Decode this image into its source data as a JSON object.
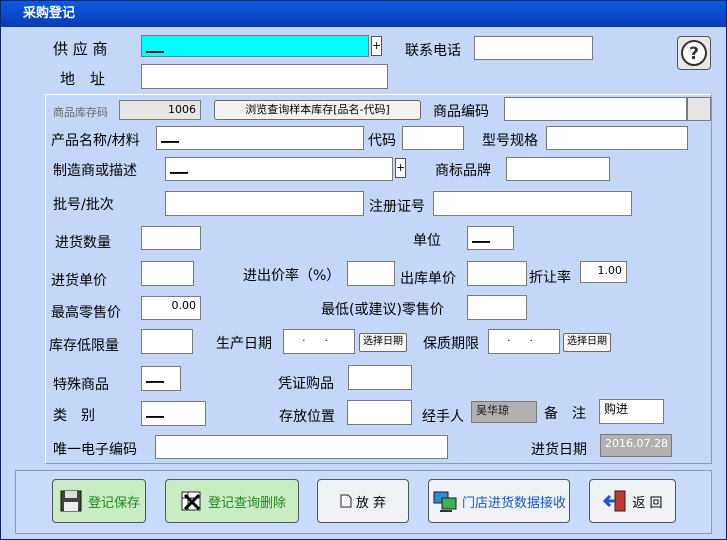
{
  "window": {
    "title": "采购登记"
  },
  "supplier": {
    "label": "供 应 商",
    "value": "___"
  },
  "phone": {
    "label": "联系电话",
    "value": ""
  },
  "address": {
    "label": "地　址",
    "value": ""
  },
  "stock_code": {
    "label": "商品库存码",
    "value": "1006"
  },
  "browse_button": {
    "label": "浏览查询样本库存[品名-代码]"
  },
  "product_code": {
    "label": "商品编码",
    "value": ""
  },
  "product_name": {
    "label": "产品名称/材料",
    "value": "___"
  },
  "code": {
    "label": "代码",
    "value": ""
  },
  "model": {
    "label": "型号规格",
    "value": ""
  },
  "manufacturer": {
    "label": "制造商或描述",
    "value": "___"
  },
  "brand": {
    "label": "商标品牌",
    "value": ""
  },
  "batch": {
    "label": "批号/批次",
    "value": ""
  },
  "reg_no": {
    "label": "注册证号",
    "value": ""
  },
  "quantity": {
    "label": "进货数量",
    "value": ""
  },
  "unit": {
    "label": "单位",
    "value": "___"
  },
  "price": {
    "label": "进货单价",
    "value": ""
  },
  "markup": {
    "label": "进出价率（%）",
    "value": ""
  },
  "out_price": {
    "label": "出库单价",
    "value": ""
  },
  "discount": {
    "label": "折让率",
    "value": "1.00"
  },
  "max_retail": {
    "label": "最高零售价",
    "value": "0.00"
  },
  "min_retail": {
    "label": "最低(或建议)零售价",
    "value": ""
  },
  "stock_limit": {
    "label": "库存低限量",
    "value": ""
  },
  "prod_date": {
    "label": "生产日期",
    "value": ". .",
    "select_label": "选择日期"
  },
  "expiry": {
    "label": "保质期限",
    "value": ". .",
    "select_label": "选择日期"
  },
  "special": {
    "label": "特殊商品",
    "value": "___"
  },
  "voucher": {
    "label": "凭证购品",
    "value": ""
  },
  "category": {
    "label": "类　别",
    "value": "___"
  },
  "location": {
    "label": "存放位置",
    "value": ""
  },
  "handler": {
    "label": "经手人",
    "value": "吴华琼"
  },
  "remark": {
    "label": "备　注",
    "value": "购进"
  },
  "ecode": {
    "label": "唯一电子编码",
    "value": ""
  },
  "purchase_date": {
    "label": "进货日期",
    "value": "2016.07.28"
  },
  "buttons": {
    "save": "登记保存",
    "query_delete": "登记查询删除",
    "discard": "放 弃",
    "receive": "门店进货数据接收",
    "back": "返 回"
  },
  "plus_symbol": "+",
  "colors": {
    "title_bar": "#0a3bb5",
    "window_bg": "#c4d7f9",
    "highlight_input": "#00ffff"
  }
}
